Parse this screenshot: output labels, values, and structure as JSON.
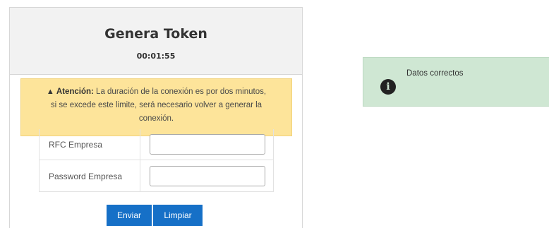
{
  "card": {
    "title": "Genera Token",
    "timer": "00:01:55"
  },
  "warning": {
    "icon": "warning-triangle-icon",
    "label": "Atención:",
    "line1": "La duración de la conexión es por dos minutos,",
    "line2": "si se excede este limite, será necesario volver a generar la",
    "line3": "conexión."
  },
  "form": {
    "rfc_label": "RFC Empresa",
    "rfc_value": "",
    "password_label": "Password Empresa",
    "password_value": ""
  },
  "buttons": {
    "enviar": "Enviar",
    "limpiar": "Limpiar"
  },
  "alert": {
    "icon": "info-icon",
    "message": "Datos correctos"
  },
  "colors": {
    "warning_bg": "#fde49a",
    "button_bg": "#1670c7",
    "alert_bg": "#cfe7d3"
  }
}
